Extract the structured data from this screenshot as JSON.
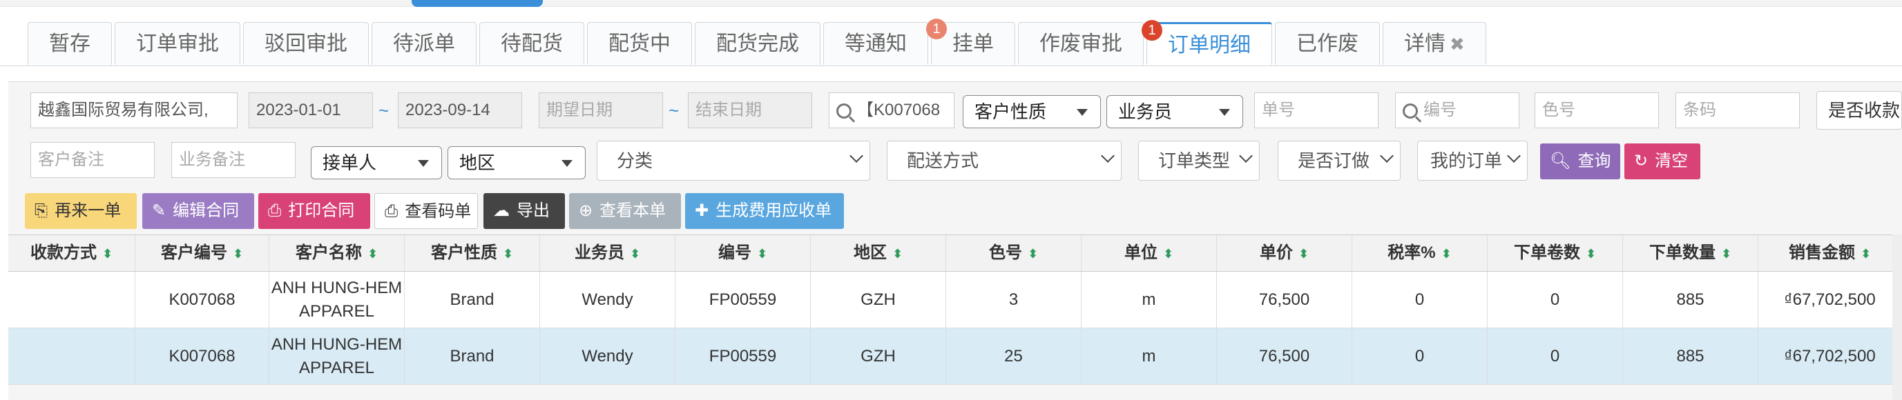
{
  "tabs": [
    {
      "label": "暂存",
      "badge": ""
    },
    {
      "label": "订单审批",
      "badge": ""
    },
    {
      "label": "驳回审批",
      "badge": ""
    },
    {
      "label": "待派单",
      "badge": ""
    },
    {
      "label": "待配货",
      "badge": ""
    },
    {
      "label": "配货中",
      "badge": ""
    },
    {
      "label": "配货完成",
      "badge": ""
    },
    {
      "label": "等通知",
      "badge": ""
    },
    {
      "label": "挂单",
      "badge": "1"
    },
    {
      "label": "作废审批",
      "badge": ""
    },
    {
      "label": "订单明细",
      "badge": "1"
    },
    {
      "label": "已作废",
      "badge": ""
    },
    {
      "label": "详情",
      "badge": ""
    }
  ],
  "active_tab": "订单明细",
  "filters": {
    "company": "越鑫国际贸易有限公司,",
    "date_from": "2023-01-01",
    "date_to": "2023-09-14",
    "tilde": "~",
    "expect_date_placeholder": "期望日期",
    "end_date_placeholder": "结束日期",
    "customer_search": "【K007068",
    "customer_type": "客户性质",
    "salesman": "业务员",
    "order_no_placeholder": "单号",
    "code_placeholder": "编号",
    "color_placeholder": "色号",
    "barcode_placeholder": "条码",
    "is_paid": "是否收款",
    "customer_remark_placeholder": "客户备注",
    "business_remark_placeholder": "业务备注",
    "receiver": "接单人",
    "region": "地区",
    "category": "分类",
    "delivery": "配送方式",
    "order_type": "订单类型",
    "is_ordered": "是否订做",
    "my_orders": "我的订单",
    "query": "查询",
    "clear": "清空"
  },
  "toolbar": {
    "reorder": "再来一单",
    "edit_contract": "编辑合同",
    "print_contract": "打印合同",
    "view_code": "查看码单",
    "export": "导出",
    "view_this": "查看本单",
    "generate_fee": "生成费用应收单"
  },
  "columns": [
    "收款方式",
    "客户编号",
    "客户名称",
    "客户性质",
    "业务员",
    "编号",
    "地区",
    "色号",
    "单位",
    "单价",
    "税率%",
    "下单卷数",
    "下单数量",
    "销售金额"
  ],
  "rows": [
    [
      "",
      "K007068",
      "ANH HUNG-HEM APPAREL",
      "Brand",
      "Wendy",
      "FP00559",
      "GZH",
      "3",
      "m",
      "76,500",
      "0",
      "0",
      "885",
      "₫67,702,500"
    ],
    [
      "",
      "K007068",
      "ANH HUNG-HEM APPAREL",
      "Brand",
      "Wendy",
      "FP00559",
      "GZH",
      "25",
      "m",
      "76,500",
      "0",
      "0",
      "885",
      "₫67,702,500"
    ]
  ],
  "selected_row": 1,
  "colors": {
    "accent": "#3a8fd8",
    "query_btn": "#8e6ab8",
    "clear_btn": "#d94277",
    "reorder_btn": "#f8d67a",
    "edit_btn": "#9b7cc4",
    "print_btn": "#d94277",
    "export_btn": "#444444",
    "view_btn": "#a9b3bb",
    "fee_btn": "#5aa7e0"
  }
}
